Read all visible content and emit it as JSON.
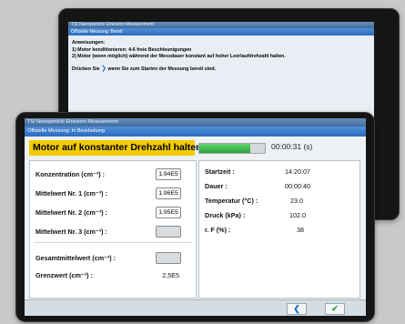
{
  "back_window": {
    "app_title": "TSI Nanoparticle Emission Measurement",
    "status": "Offizielle Messung: Bereit",
    "instructions_heading": "Anweisungen:",
    "step_1": "1) Motor konditionieren: 4-6 freie Beschleunigungen",
    "step_2": "2) Motor (wenn möglich) während der Messdauer konstant auf hoher Leerlaufdrehzahl halten.",
    "prompt_before": "Drücken Sie",
    "prompt_after": "wenn Sie zum Starten der Messung bereit sind.",
    "prompt_icon": "chevron-right-icon"
  },
  "front_window": {
    "app_title": "TSI Nanoparticle Emission Measurement",
    "status": "Offizielle Messung: In Bearbeitung",
    "banner_text": "Motor auf konstanter Drehzahl halten.",
    "banner_color": "#f3cb00",
    "progress_fraction": 0.78,
    "timer": "00:00:31 (s)",
    "measurements": [
      {
        "label": "Konzentration (cm⁻³) :",
        "value": "1.94E5"
      },
      {
        "label": "Mittelwert Nr. 1 (cm⁻³) :",
        "value": "1.96E5"
      },
      {
        "label": "Mittelwert Nr. 2 (cm⁻³) :",
        "value": "1.95E5"
      },
      {
        "label": "Mittelwert Nr. 3 (cm⁻³) :",
        "value": ""
      }
    ],
    "total": {
      "label": "Gesamtmittelwert (cm⁻³) :",
      "value": ""
    },
    "limit": {
      "label": "Grenzwert (cm⁻³) :",
      "value": "2,5E5"
    },
    "info": [
      {
        "label": "Startzeit :",
        "value": "14:20:07"
      },
      {
        "label": "Dauer :",
        "value": "00:00:40"
      },
      {
        "label": "Temperatur (°C) :",
        "value": "23.0"
      },
      {
        "label": "Druck (kPa) :",
        "value": "102.0"
      },
      {
        "label": "r. F (%) :",
        "value": "38"
      }
    ],
    "nav_back_icon": "chevron-left-icon",
    "nav_ok_icon": "checkmark-icon"
  }
}
